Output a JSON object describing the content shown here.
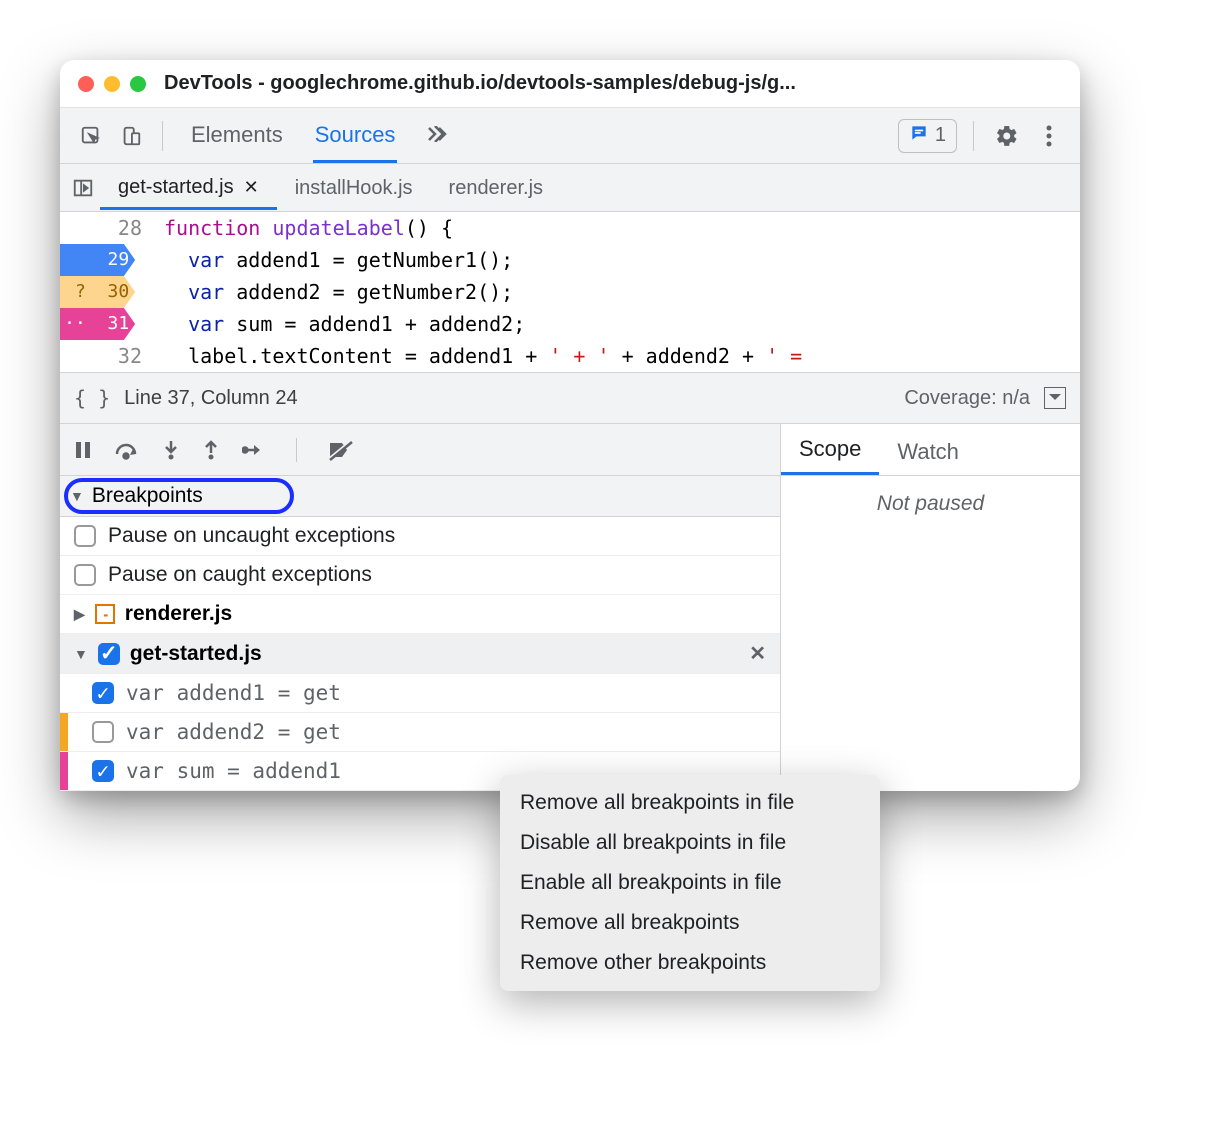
{
  "window": {
    "title": "DevTools - googlechrome.github.io/devtools-samples/debug-js/g..."
  },
  "toolbar": {
    "tabs": {
      "elements": "Elements",
      "sources": "Sources"
    },
    "issues_count": "1"
  },
  "file_tabs": [
    {
      "name": "get-started.js",
      "active": true,
      "closable": true
    },
    {
      "name": "installHook.js",
      "active": false,
      "closable": false
    },
    {
      "name": "renderer.js",
      "active": false,
      "closable": false
    }
  ],
  "code": {
    "lines": [
      {
        "n": "28",
        "bp": "",
        "html": "function updateLabel() {",
        "tokens": [
          [
            "kw",
            "function "
          ],
          [
            "fn",
            "updateLabel"
          ],
          [
            "",
            "() {"
          ]
        ]
      },
      {
        "n": "29",
        "bp": "blue",
        "html": "  var addend1 = getNumber1();",
        "tokens": [
          [
            "",
            "  "
          ],
          [
            "blue",
            "var"
          ],
          [
            "",
            " addend1 = getNumber1();"
          ]
        ]
      },
      {
        "n": "30",
        "bp": "orange",
        "marker": "?",
        "html": "  var addend2 = getNumber2();",
        "tokens": [
          [
            "",
            "  "
          ],
          [
            "blue",
            "var"
          ],
          [
            "",
            " addend2 = getNumber2();"
          ]
        ]
      },
      {
        "n": "31",
        "bp": "pink",
        "marker": "··",
        "html": "  var sum = addend1 + addend2;",
        "tokens": [
          [
            "",
            "  "
          ],
          [
            "blue",
            "var"
          ],
          [
            "",
            " sum = addend1 + addend2;"
          ]
        ]
      },
      {
        "n": "32",
        "bp": "",
        "html": "  label.textContent = addend1 + ' + ' + addend2 + ' =",
        "tokens": [
          [
            "",
            "  label.textContent = addend1 + "
          ],
          [
            "str",
            "' + '"
          ],
          [
            "",
            " + addend2 + "
          ],
          [
            "str",
            "' ="
          ]
        ]
      }
    ]
  },
  "statusbar": {
    "position": "Line 37, Column 24",
    "coverage": "Coverage: n/a"
  },
  "scope_watch": {
    "scope": "Scope",
    "watch": "Watch",
    "not_paused": "Not paused"
  },
  "breakpoints": {
    "header": "Breakpoints",
    "pause_uncaught": "Pause on uncaught exceptions",
    "pause_caught": "Pause on caught exceptions",
    "groups": [
      {
        "file": "renderer.js",
        "expanded": false,
        "checked": false,
        "lines": []
      },
      {
        "file": "get-started.js",
        "expanded": true,
        "checked": true,
        "selected": true,
        "lines": [
          {
            "text": "var addend1 = get",
            "checked": true,
            "strip": ""
          },
          {
            "text": "var addend2 = get",
            "checked": false,
            "strip": "orange"
          },
          {
            "text": "var sum = addend1",
            "checked": true,
            "strip": "pink"
          }
        ]
      }
    ]
  },
  "context_menu": [
    "Remove all breakpoints in file",
    "Disable all breakpoints in file",
    "Enable all breakpoints in file",
    "Remove all breakpoints",
    "Remove other breakpoints"
  ]
}
